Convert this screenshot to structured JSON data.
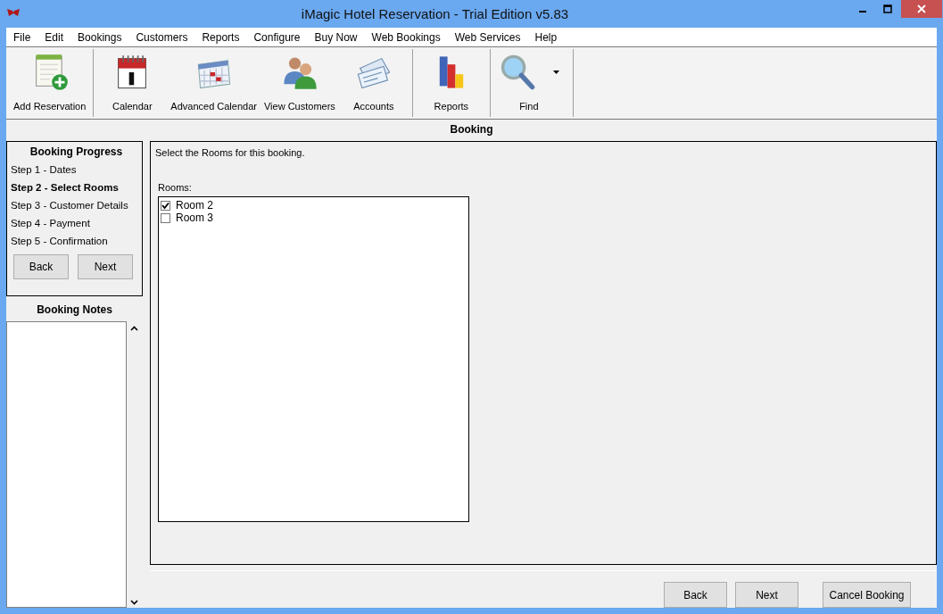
{
  "window": {
    "title": "iMagic Hotel Reservation - Trial Edition v5.83"
  },
  "menu": [
    "File",
    "Edit",
    "Bookings",
    "Customers",
    "Reports",
    "Configure",
    "Buy Now",
    "Web Bookings",
    "Web Services",
    "Help"
  ],
  "toolbar": [
    [
      {
        "label": "Add Reservation",
        "dropdown": false
      }
    ],
    [
      {
        "label": "Calendar",
        "dropdown": false
      },
      {
        "label": "Advanced Calendar",
        "dropdown": false
      },
      {
        "label": "View Customers",
        "dropdown": false
      },
      {
        "label": "Accounts",
        "dropdown": false
      }
    ],
    [
      {
        "label": "Reports",
        "dropdown": false
      }
    ],
    [
      {
        "label": "Find",
        "dropdown": true
      }
    ]
  ],
  "section_title": "Booking",
  "progress": {
    "title": "Booking Progress",
    "steps": [
      {
        "label": "Step 1 - Dates",
        "selected": false
      },
      {
        "label": "Step 2 - Select Rooms",
        "selected": true
      },
      {
        "label": "Step 3 - Customer Details",
        "selected": false
      },
      {
        "label": "Step 4 - Payment",
        "selected": false
      },
      {
        "label": "Step 5 - Confirmation",
        "selected": false
      }
    ],
    "buttons": [
      "Back",
      "Next"
    ]
  },
  "notes": {
    "title": "Booking Notes"
  },
  "main": {
    "instruction": "Select the Rooms for this booking.",
    "rooms_label": "Rooms:",
    "rooms": [
      {
        "label": "Room 2",
        "checked": true
      },
      {
        "label": "Room 3",
        "checked": false
      }
    ]
  },
  "footer_buttons": [
    "Back",
    "Next",
    "Cancel Booking"
  ]
}
